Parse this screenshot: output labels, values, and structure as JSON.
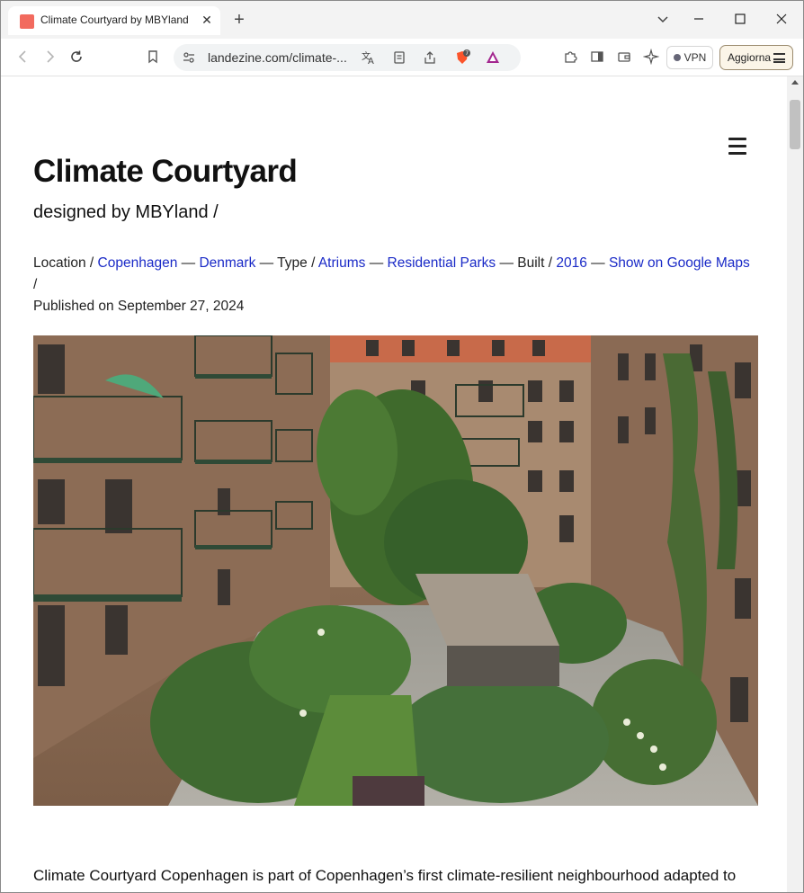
{
  "browser": {
    "tab_title": "Climate Courtyard by MBYland",
    "tab_close": "✕",
    "new_tab": "+",
    "window_controls": {
      "dropdown": "⌄",
      "minimize": "—",
      "maximize": "☐",
      "close": "✕"
    },
    "url": "landezine.com/climate-...",
    "vpn_label": "VPN",
    "update_button": "Aggiorna",
    "brave_badge": "7",
    "icons": [
      "back-icon",
      "forward-icon",
      "reload-icon",
      "bookmark-icon",
      "site-settings-icon",
      "translate-icon",
      "reader-mode-icon",
      "share-icon",
      "brave-shields-icon",
      "brave-rewards-icon",
      "extensions-icon",
      "sidebar-icon",
      "wallet-icon",
      "leo-ai-icon"
    ]
  },
  "article": {
    "title": "Climate Courtyard",
    "subtitle": "designed by MBYland /",
    "meta": {
      "location_label": "Location /",
      "city": "Copenhagen",
      "sep1": "—",
      "country": "Denmark",
      "type_label": "— Type /",
      "type1": "Atriums",
      "sep2": "—",
      "type2": "Residential Parks",
      "built_label": "— Built /",
      "year": "2016",
      "sep3": "—",
      "maps_link": "Show on Google Maps",
      "slash": "/",
      "published": "Published on September 27, 2024"
    },
    "body_first_line": "Climate Courtyard Copenhagen is part of Copenhagen’s first climate-resilient neighbourhood adapted to"
  },
  "colors": {
    "link": "#1a2ac7",
    "tab_favicon": "#f26a5e",
    "update_button_bg": "#fbf5e8"
  }
}
